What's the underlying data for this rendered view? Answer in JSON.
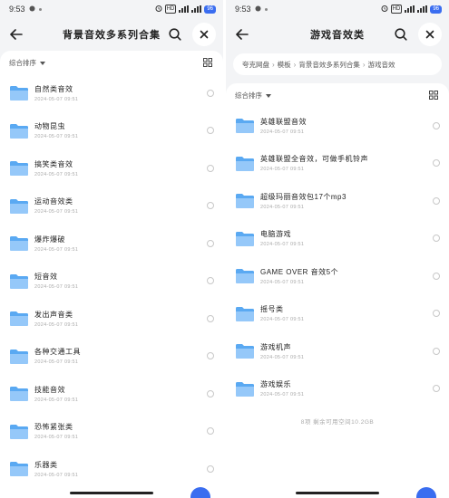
{
  "status": {
    "time": "9:53",
    "network_badge": "HD",
    "battery_label": "96"
  },
  "left": {
    "title": "背景音效多系列合集",
    "sort_label": "综合排序",
    "items": [
      {
        "name": "自然类音效",
        "date": "2024-05-07 09:51"
      },
      {
        "name": "动物昆虫",
        "date": "2024-05-07 09:51"
      },
      {
        "name": "搞笑类音效",
        "date": "2024-05-07 09:51"
      },
      {
        "name": "运动音效类",
        "date": "2024-05-07 09:51"
      },
      {
        "name": "爆炸爆破",
        "date": "2024-05-07 09:51"
      },
      {
        "name": "短音效",
        "date": "2024-05-07 09:51"
      },
      {
        "name": "发出声音类",
        "date": "2024-05-07 09:51"
      },
      {
        "name": "各种交通工具",
        "date": "2024-05-07 09:51"
      },
      {
        "name": "技能音效",
        "date": "2024-05-07 09:51"
      },
      {
        "name": "恐怖紧张类",
        "date": "2024-05-07 09:51"
      },
      {
        "name": "乐器类",
        "date": "2024-05-07 09:51"
      }
    ]
  },
  "right": {
    "title": "游戏音效类",
    "breadcrumb": [
      "夸克网盘",
      "模板",
      "背景音效多系列合集",
      "游戏音效"
    ],
    "sort_label": "综合排序",
    "items": [
      {
        "name": "英雄联盟音效",
        "date": "2024-05-07 09:51"
      },
      {
        "name": "英雄联盟全音效，可做手机铃声",
        "date": "2024-05-07 09:51"
      },
      {
        "name": "超级玛丽音效包17个mp3",
        "date": "2024-05-07 09:51"
      },
      {
        "name": "电脑游戏",
        "date": "2024-05-07 09:51"
      },
      {
        "name": "GAME OVER 音效5个",
        "date": "2024-05-07 09:51"
      },
      {
        "name": "摇号类",
        "date": "2024-05-07 09:51"
      },
      {
        "name": "游戏机声",
        "date": "2024-05-07 09:51"
      },
      {
        "name": "游戏娱乐",
        "date": "2024-05-07 09:51"
      }
    ],
    "footer": "8项  剩余可用空间10.2GB"
  },
  "colors": {
    "accent": "#3a6df0",
    "folder": "#5aa9f2",
    "folder_light": "#a9d3fb"
  },
  "icons": [
    "back-arrow-icon",
    "search-icon",
    "close-icon",
    "grid-view-icon",
    "folder-icon",
    "radio-icon"
  ]
}
